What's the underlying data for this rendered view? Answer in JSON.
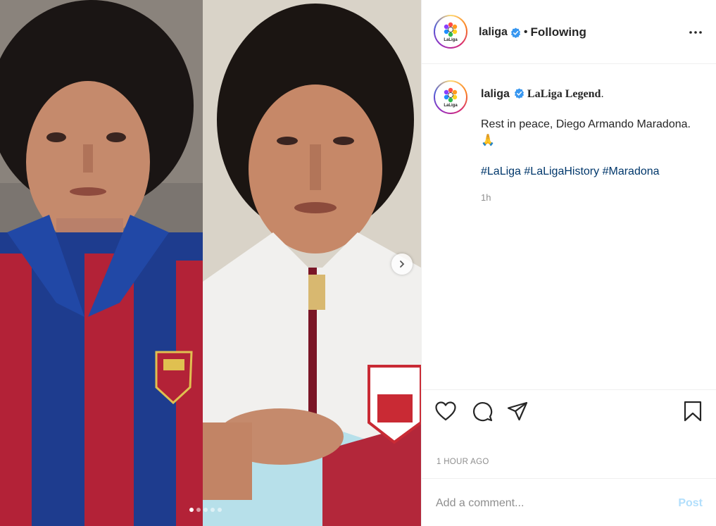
{
  "post": {
    "username": "laliga",
    "following_label": "Following",
    "separator": "•",
    "caption_title": "LaLiga Legend",
    "caption_title_suffix": ".",
    "caption_text": "Rest in peace, Diego Armando Maradona. 🙏",
    "hashtags": [
      "#LaLiga",
      "#LaLigaHistory",
      "#Maradona"
    ],
    "relative_time": "1h",
    "time_ago": "1 HOUR AGO"
  },
  "avatar": {
    "logo_text": "LaLiga",
    "icon": "laliga-logo-icon"
  },
  "carousel": {
    "slides": 5,
    "active_index": 0,
    "next_icon": "chevron-right-icon"
  },
  "actions": [
    "heart-icon",
    "comment-icon",
    "share-icon",
    "bookmark-icon"
  ],
  "comment": {
    "placeholder": "Add a comment...",
    "post_label": "Post"
  },
  "colors": {
    "text": "#262626",
    "muted": "#8e8e8e",
    "hashtag": "#00376b",
    "post_disabled": "#b2dffc",
    "verified": "#3897f0"
  }
}
